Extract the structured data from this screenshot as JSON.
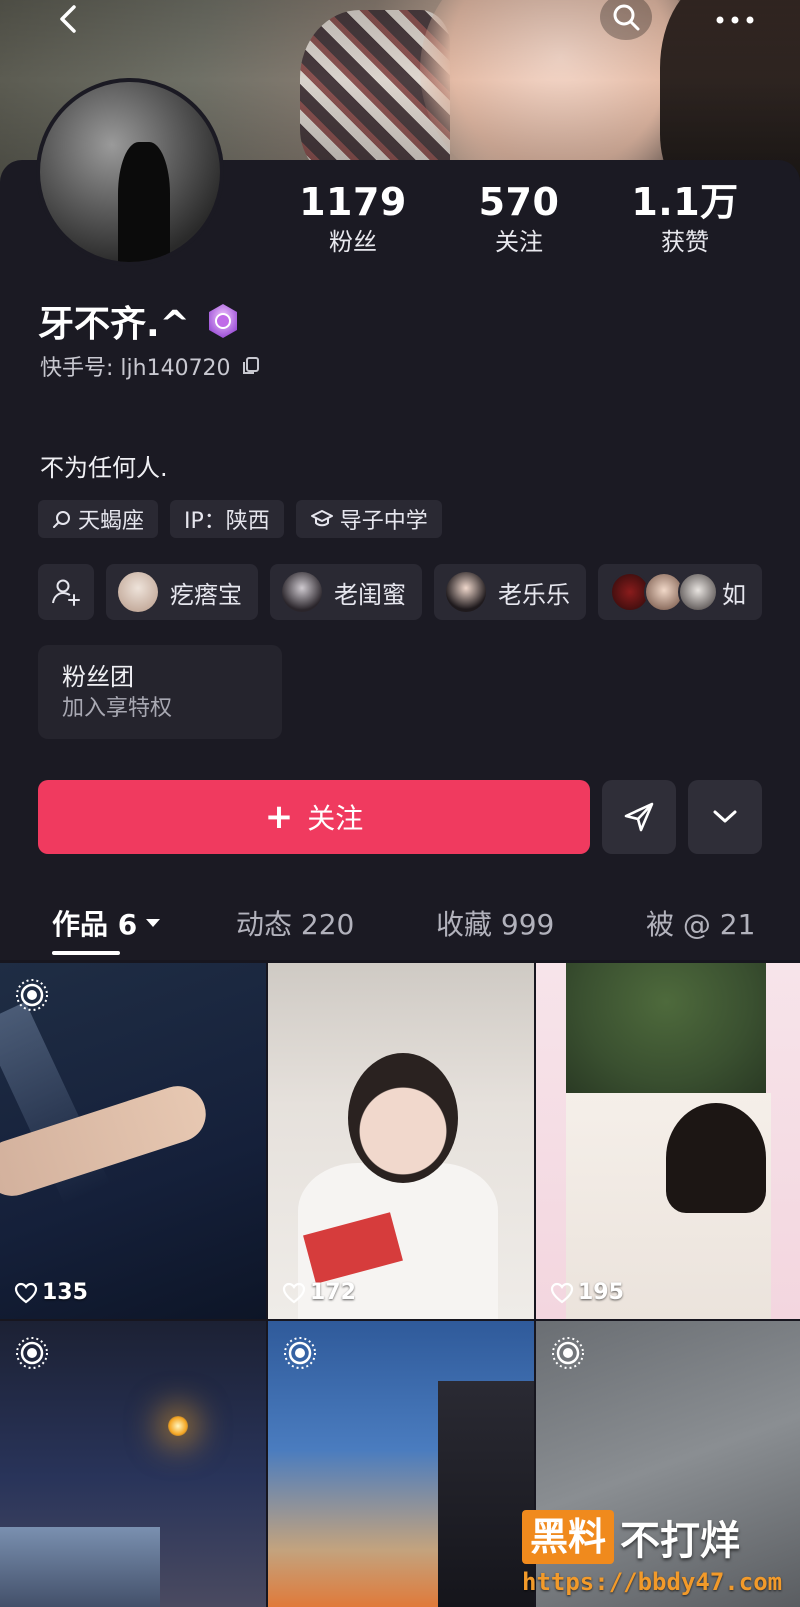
{
  "profile": {
    "name": "牙不齐.^",
    "kuaishou_id": "快手号: ljh140720",
    "bio": "不为任何人."
  },
  "stats": [
    {
      "value": "1179",
      "label": "粉丝"
    },
    {
      "value": "570",
      "label": "关注"
    },
    {
      "value": "1.1万",
      "label": "获赞"
    }
  ],
  "tags": [
    {
      "icon": "search-icon",
      "label": "天蝎座"
    },
    {
      "icon": "",
      "label": "IP：陕西"
    },
    {
      "icon": "school-icon",
      "label": "导子中学"
    }
  ],
  "friends": [
    {
      "label": "疙瘩宝",
      "color": "#d9c6b8"
    },
    {
      "label": "老闺蜜",
      "color": "#4a4450"
    },
    {
      "label": "老乐乐",
      "color": "#2c2428"
    },
    {
      "label": "如",
      "colors": [
        "#5a1414",
        "#c9a28f",
        "#d9d4d0"
      ]
    }
  ],
  "fan_club": {
    "title": "粉丝团",
    "subtitle": "加入享特权"
  },
  "actions": {
    "follow_label": "关注"
  },
  "tabs": [
    {
      "label": "作品 6",
      "active": true
    },
    {
      "label": "动态 220"
    },
    {
      "label": "收藏 999"
    },
    {
      "label": "被 @ 21"
    }
  ],
  "works": [
    {
      "likes": "135"
    },
    {
      "likes": "172"
    },
    {
      "likes": "195"
    },
    {
      "likes": ""
    },
    {
      "likes": ""
    },
    {
      "likes": ""
    }
  ],
  "watermark": {
    "box": "黑料",
    "text": "不打烊",
    "url": "https://bbdy47.com"
  },
  "colors": {
    "accent": "#f03a5f",
    "background": "#1b1a23",
    "chip": "#2a2933"
  }
}
